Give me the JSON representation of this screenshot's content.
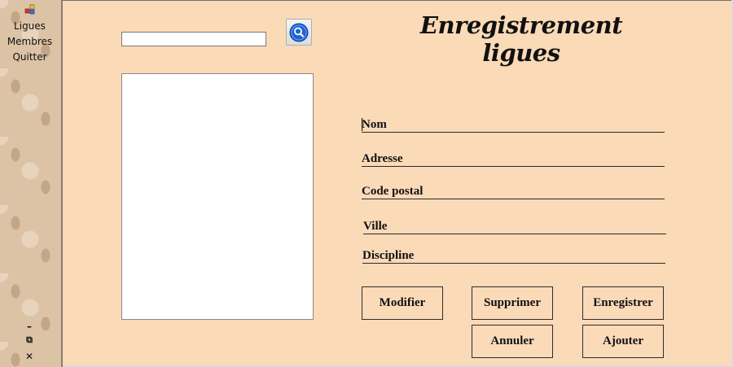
{
  "sidebar": {
    "menu": [
      {
        "label": "Ligues"
      },
      {
        "label": "Membres"
      },
      {
        "label": "Quitter"
      }
    ],
    "window_controls": {
      "minimize": "–",
      "restore": "⧉",
      "close": "✕"
    }
  },
  "search": {
    "value": "",
    "placeholder": ""
  },
  "title": "Enregistrement ligues",
  "fields": [
    {
      "label": "Nom"
    },
    {
      "label": "Adresse"
    },
    {
      "label": "Code postal"
    },
    {
      "label": "Ville"
    },
    {
      "label": "Discipline"
    }
  ],
  "buttons": {
    "modifier": "Modifier",
    "supprimer": "Supprimer",
    "enregistrer": "Enregistrer",
    "annuler": "Annuler",
    "ajouter": "Ajouter"
  },
  "icons": {
    "app": "app-icon",
    "search": "magnifier-icon"
  },
  "colors": {
    "background": "#fbdab8",
    "search_accent": "#1e63d6"
  }
}
